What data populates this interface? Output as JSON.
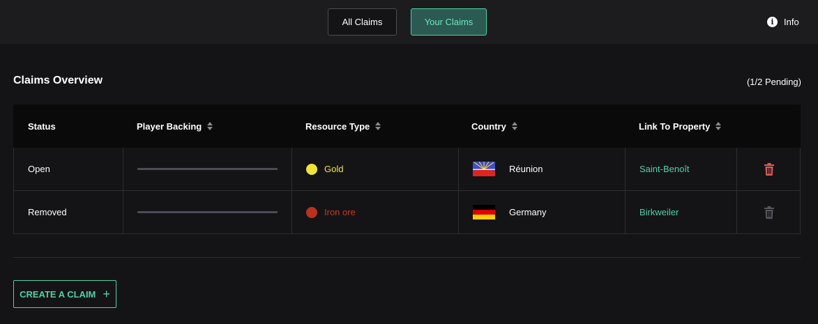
{
  "tabs": {
    "all_label": "All Claims",
    "yours_label": "Your Claims"
  },
  "info": {
    "icon": "info-icon",
    "label": "Info"
  },
  "overview": {
    "title": "Claims Overview",
    "pending": "(1/2 Pending)"
  },
  "table": {
    "headers": [
      "Status",
      "Player Backing",
      "Resource Type",
      "Country",
      "Link To Property"
    ],
    "rows": [
      {
        "status": "Open",
        "backing": 0,
        "resource": "Gold",
        "resource_color": "#f2e437",
        "resource_text_color": "#f2e437",
        "flag": "reunion-flag",
        "country": "Réunion",
        "property": "Saint-Benoît",
        "delete_icon": "trash-icon",
        "delete_color": "#e05a5a"
      },
      {
        "status": "Removed",
        "backing": 0,
        "resource": "Iron ore",
        "resource_color": "#b8321e",
        "resource_text_color": "#c23a25",
        "flag": "germany-flag",
        "country": "Germany",
        "property": "Birkweiler",
        "delete_icon": "trash-icon",
        "delete_color": "#55565c"
      }
    ]
  },
  "create_button": {
    "label": "CREATE A CLAIM",
    "icon": "plus-icon"
  },
  "colors": {
    "accent": "#4fd1a5",
    "background": "#141416",
    "header": "#0a0a0b"
  }
}
